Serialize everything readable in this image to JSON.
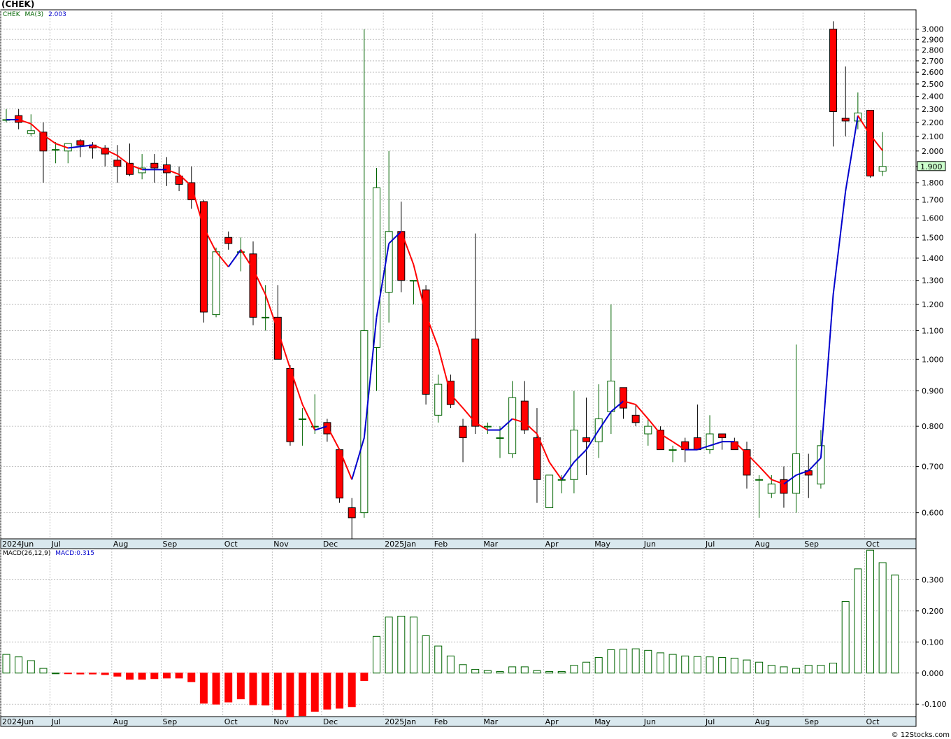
{
  "header": {
    "title": "(CHEK)",
    "credit": "© 12Stocks.com"
  },
  "legend": {
    "symbol": "CHEK",
    "ma_label": "MA(3)",
    "ma_value": "2.003",
    "macd_label": "MACD(26,12,9)",
    "macd_value": "MACD:0.315"
  },
  "colors": {
    "up": "#006400",
    "down": "#ff0000",
    "ma_up": "#0000cc",
    "ma_down": "#ff0000",
    "axis_bg": "#d9e8ee",
    "grid": "#b0b0b0",
    "last_price_bg": "#ccffcc"
  },
  "chart_data": [
    {
      "type": "candlestick",
      "title": "(CHEK)",
      "y_scale": "log",
      "ylim": [
        0.55,
        3.2
      ],
      "y_ticks": [
        "3.000",
        "2.900",
        "2.800",
        "2.700",
        "2.600",
        "2.500",
        "2.400",
        "2.300",
        "2.200",
        "2.100",
        "2.000",
        "1.900",
        "1.800",
        "1.700",
        "1.600",
        "1.500",
        "1.400",
        "1.300",
        "1.200",
        "1.100",
        "1.000",
        "0.900",
        "0.800",
        "0.700",
        "0.600"
      ],
      "last_price": "1.900",
      "x_labels": [
        {
          "label": "2024Jun",
          "i": 0
        },
        {
          "label": "Jul",
          "i": 4
        },
        {
          "label": "Aug",
          "i": 9
        },
        {
          "label": "Sep",
          "i": 13
        },
        {
          "label": "Oct",
          "i": 18
        },
        {
          "label": "Nov",
          "i": 22
        },
        {
          "label": "Dec",
          "i": 26
        },
        {
          "label": "2025Jan",
          "i": 31
        },
        {
          "label": "Feb",
          "i": 35
        },
        {
          "label": "Mar",
          "i": 39
        },
        {
          "label": "Apr",
          "i": 44
        },
        {
          "label": "May",
          "i": 48
        },
        {
          "label": "Jun",
          "i": 52
        },
        {
          "label": "Jul",
          "i": 57
        },
        {
          "label": "Aug",
          "i": 61
        },
        {
          "label": "Sep",
          "i": 65
        },
        {
          "label": "Oct",
          "i": 70
        }
      ],
      "ohlc": [
        [
          2.22,
          2.3,
          2.2,
          2.22
        ],
        [
          2.25,
          2.3,
          2.15,
          2.2
        ],
        [
          2.12,
          2.26,
          2.1,
          2.14
        ],
        [
          2.13,
          2.2,
          1.8,
          2.0
        ],
        [
          2.01,
          2.06,
          1.92,
          2.01
        ],
        [
          2.0,
          2.05,
          1.92,
          2.05
        ],
        [
          2.07,
          2.08,
          1.96,
          2.04
        ],
        [
          2.04,
          2.06,
          1.95,
          2.02
        ],
        [
          2.02,
          2.04,
          1.9,
          1.98
        ],
        [
          1.94,
          2.04,
          1.8,
          1.9
        ],
        [
          1.92,
          2.05,
          1.84,
          1.85
        ],
        [
          1.86,
          1.98,
          1.82,
          1.89
        ],
        [
          1.92,
          1.98,
          1.8,
          1.89
        ],
        [
          1.91,
          1.96,
          1.78,
          1.86
        ],
        [
          1.84,
          1.9,
          1.75,
          1.79
        ],
        [
          1.8,
          1.9,
          1.65,
          1.7
        ],
        [
          1.69,
          1.7,
          1.13,
          1.17
        ],
        [
          1.16,
          1.45,
          1.15,
          1.43
        ],
        [
          1.5,
          1.53,
          1.44,
          1.47
        ],
        [
          1.43,
          1.5,
          1.34,
          1.43
        ],
        [
          1.42,
          1.48,
          1.12,
          1.15
        ],
        [
          1.15,
          1.28,
          1.1,
          1.15
        ],
        [
          1.15,
          1.28,
          1.0,
          1.0
        ],
        [
          0.97,
          0.98,
          0.75,
          0.76
        ],
        [
          0.82,
          0.85,
          0.75,
          0.82
        ],
        [
          0.8,
          0.89,
          0.78,
          0.8
        ],
        [
          0.81,
          0.82,
          0.76,
          0.78
        ],
        [
          0.74,
          0.74,
          0.62,
          0.63
        ],
        [
          0.61,
          0.63,
          0.55,
          0.59
        ],
        [
          0.6,
          3.0,
          0.59,
          1.1
        ],
        [
          1.04,
          1.89,
          0.9,
          1.77
        ],
        [
          1.25,
          2.0,
          1.13,
          1.53
        ],
        [
          1.53,
          1.69,
          1.25,
          1.3
        ],
        [
          1.3,
          1.3,
          1.2,
          1.3
        ],
        [
          1.26,
          1.28,
          0.86,
          0.89
        ],
        [
          0.83,
          0.95,
          0.81,
          0.92
        ],
        [
          0.93,
          0.95,
          0.85,
          0.86
        ],
        [
          0.8,
          0.82,
          0.71,
          0.77
        ],
        [
          1.07,
          1.52,
          0.78,
          0.8
        ],
        [
          0.8,
          0.81,
          0.78,
          0.8
        ],
        [
          0.77,
          0.8,
          0.72,
          0.77
        ],
        [
          0.73,
          0.93,
          0.72,
          0.88
        ],
        [
          0.87,
          0.93,
          0.78,
          0.79
        ],
        [
          0.77,
          0.85,
          0.62,
          0.67
        ],
        [
          0.61,
          0.68,
          0.61,
          0.68
        ],
        [
          0.67,
          0.68,
          0.64,
          0.67
        ],
        [
          0.67,
          0.9,
          0.64,
          0.79
        ],
        [
          0.77,
          0.88,
          0.68,
          0.76
        ],
        [
          0.76,
          0.92,
          0.72,
          0.82
        ],
        [
          0.84,
          1.2,
          0.78,
          0.93
        ],
        [
          0.91,
          0.91,
          0.82,
          0.85
        ],
        [
          0.83,
          0.86,
          0.8,
          0.81
        ],
        [
          0.78,
          0.82,
          0.75,
          0.8
        ],
        [
          0.79,
          0.8,
          0.74,
          0.74
        ],
        [
          0.74,
          0.75,
          0.71,
          0.74
        ],
        [
          0.76,
          0.77,
          0.71,
          0.74
        ],
        [
          0.77,
          0.86,
          0.74,
          0.74
        ],
        [
          0.74,
          0.83,
          0.73,
          0.78
        ],
        [
          0.78,
          0.78,
          0.74,
          0.77
        ],
        [
          0.76,
          0.77,
          0.74,
          0.74
        ],
        [
          0.74,
          0.76,
          0.65,
          0.68
        ],
        [
          0.67,
          0.68,
          0.59,
          0.67
        ],
        [
          0.64,
          0.68,
          0.63,
          0.66
        ],
        [
          0.67,
          0.7,
          0.61,
          0.64
        ],
        [
          0.64,
          1.05,
          0.6,
          0.73
        ],
        [
          0.69,
          0.73,
          0.63,
          0.68
        ],
        [
          0.66,
          0.79,
          0.65,
          0.75
        ],
        [
          3.0,
          3.08,
          2.03,
          2.28
        ],
        [
          2.23,
          2.65,
          2.1,
          2.21
        ],
        [
          2.21,
          2.43,
          2.15,
          2.27
        ],
        [
          2.29,
          2.29,
          1.83,
          1.84
        ],
        [
          1.87,
          2.13,
          1.84,
          1.9
        ]
      ],
      "ma3": [
        2.22,
        2.22,
        2.19,
        2.11,
        2.05,
        2.02,
        2.03,
        2.04,
        2.01,
        1.97,
        1.91,
        1.88,
        1.88,
        1.88,
        1.85,
        1.78,
        1.55,
        1.43,
        1.36,
        1.44,
        1.35,
        1.24,
        1.1,
        0.97,
        0.86,
        0.79,
        0.8,
        0.74,
        0.67,
        0.77,
        1.15,
        1.47,
        1.53,
        1.37,
        1.16,
        1.04,
        0.89,
        0.85,
        0.81,
        0.79,
        0.79,
        0.82,
        0.81,
        0.78,
        0.71,
        0.67,
        0.71,
        0.74,
        0.79,
        0.84,
        0.87,
        0.86,
        0.82,
        0.78,
        0.76,
        0.74,
        0.74,
        0.75,
        0.76,
        0.76,
        0.73,
        0.7,
        0.67,
        0.66,
        0.68,
        0.69,
        0.72,
        1.24,
        1.75,
        2.25,
        2.11,
        2.003
      ]
    },
    {
      "type": "bar",
      "title": "MACD(26,12,9)",
      "ylim": [
        -0.14,
        0.4
      ],
      "y_ticks": [
        "0.300",
        "0.200",
        "0.100",
        "0.000",
        "-0.100"
      ],
      "values": [
        0.06,
        0.052,
        0.04,
        0.015,
        0.0,
        -0.002,
        -0.003,
        -0.003,
        -0.005,
        -0.01,
        -0.02,
        -0.02,
        -0.018,
        -0.016,
        -0.016,
        -0.028,
        -0.097,
        -0.1,
        -0.093,
        -0.083,
        -0.102,
        -0.103,
        -0.117,
        -0.141,
        -0.137,
        -0.123,
        -0.116,
        -0.113,
        -0.108,
        -0.024,
        0.118,
        0.18,
        0.183,
        0.18,
        0.12,
        0.087,
        0.055,
        0.027,
        0.012,
        0.008,
        0.005,
        0.02,
        0.02,
        0.008,
        0.005,
        0.005,
        0.025,
        0.035,
        0.05,
        0.075,
        0.077,
        0.078,
        0.073,
        0.065,
        0.06,
        0.055,
        0.053,
        0.052,
        0.05,
        0.048,
        0.042,
        0.035,
        0.025,
        0.02,
        0.015,
        0.025,
        0.025,
        0.032,
        0.23,
        0.335,
        0.395,
        0.355,
        0.315
      ]
    }
  ]
}
